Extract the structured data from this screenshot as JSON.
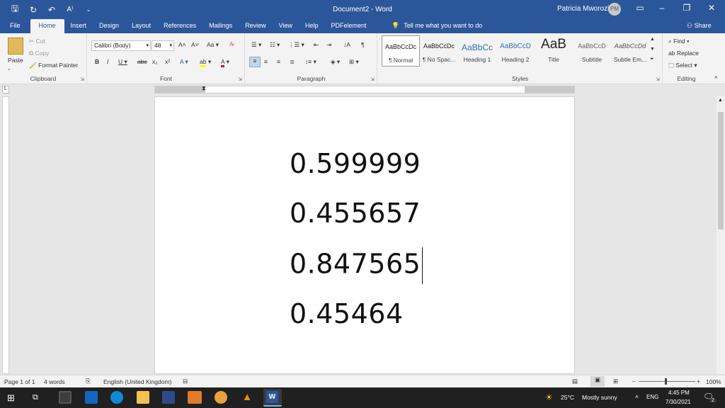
{
  "titlebar": {
    "document_title": "Document2  -  Word",
    "user_name": "Patricia Mworozi",
    "user_initials": "PM"
  },
  "tabs": [
    "File",
    "Home",
    "Insert",
    "Design",
    "Layout",
    "References",
    "Mailings",
    "Review",
    "View",
    "Help",
    "PDFelement"
  ],
  "tell_me": "Tell me what you want to do",
  "share": "Share",
  "clipboard": {
    "paste": "Paste",
    "cut": "Cut",
    "copy": "Copy",
    "format_painter": "Format Painter",
    "label": "Clipboard"
  },
  "font": {
    "name": "Calibri (Body)",
    "size": "48",
    "label": "Font"
  },
  "paragraph": {
    "label": "Paragraph"
  },
  "styles": {
    "label": "Styles",
    "items": [
      {
        "preview": "AaBbCcDc",
        "name": "¶ Normal"
      },
      {
        "preview": "AaBbCcDc",
        "name": "¶ No Spac..."
      },
      {
        "preview": "AaBbCc",
        "name": "Heading 1"
      },
      {
        "preview": "AaBbCcD",
        "name": "Heading 2"
      },
      {
        "preview": "AaB",
        "name": "Title"
      },
      {
        "preview": "AaBbCcD",
        "name": "Subtitle"
      },
      {
        "preview": "AaBbCcDd",
        "name": "Subtle Em..."
      }
    ]
  },
  "editing": {
    "find": "Find",
    "replace": "Replace",
    "select": "Select",
    "label": "Editing"
  },
  "document": {
    "lines": [
      "0.599999",
      "0.455657",
      "0.847565",
      "0.45464"
    ]
  },
  "statusbar": {
    "page": "Page 1 of 1",
    "words": "4 words",
    "language": "English (United Kingdom)",
    "zoom": "100%"
  },
  "taskbar": {
    "weather_temp": "25°C",
    "weather_desc": "Mostly sunny",
    "lang": "ENG",
    "time": "4:45 PM",
    "date": "7/30/2021",
    "notifications": "2"
  }
}
